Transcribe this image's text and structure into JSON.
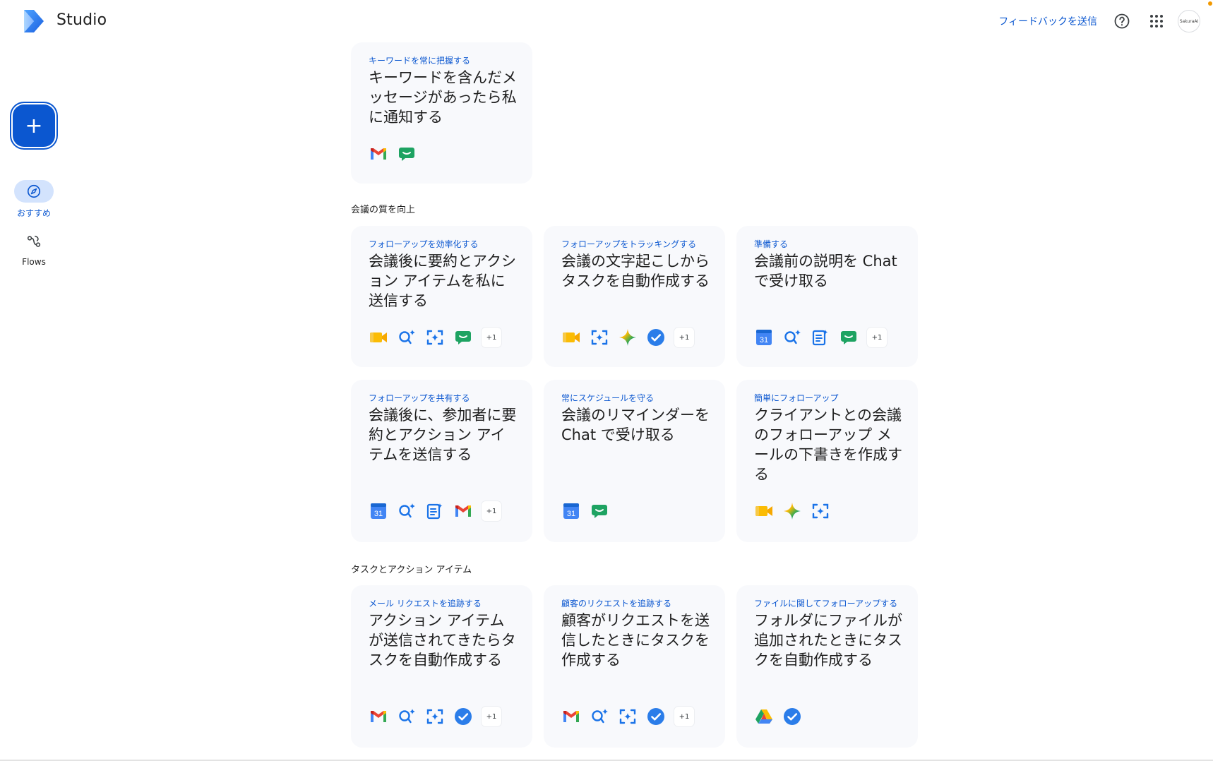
{
  "app": {
    "title": "Studio"
  },
  "header": {
    "feedback_label": "フィードバックを送信",
    "avatar_text": "SakuraAI"
  },
  "nav": {
    "create_label": "+",
    "items": [
      {
        "label": "おすすめ",
        "icon": "compass-icon",
        "active": true
      },
      {
        "label": "Flows",
        "icon": "flows-icon",
        "active": false
      }
    ]
  },
  "sections": [
    {
      "title": "会議の質を向上"
    },
    {
      "title": "タスクとアクション アイテム"
    }
  ],
  "cards": [
    {
      "subtitle": "キーワードを常に把握する",
      "title": "キーワードを含んだメッセージがあったら私に通知する",
      "icons": [
        "gmail-icon",
        "chat-icon"
      ],
      "more": ""
    },
    {
      "subtitle": "フォローアップを効率化する",
      "title": "会議後に要約とアクション アイテムを私に送信する",
      "icons": [
        "meet-icon",
        "gemini-task-icon",
        "capture-icon",
        "chat-icon"
      ],
      "more": "+1"
    },
    {
      "subtitle": "フォローアップをトラッキングする",
      "title": "会議の文字起こしからタスクを自動作成する",
      "icons": [
        "meet-icon",
        "capture-icon",
        "gemini-icon",
        "tasks-icon"
      ],
      "more": "+1"
    },
    {
      "subtitle": "準備する",
      "title": "会議前の説明を Chat で受け取る",
      "icons": [
        "calendar-icon",
        "gemini-task-icon",
        "notes-icon",
        "chat-icon"
      ],
      "more": "+1"
    },
    {
      "subtitle": "フォローアップを共有する",
      "title": "会議後に、参加者に要約とアクション アイテムを送信する",
      "icons": [
        "calendar-icon",
        "gemini-task-icon",
        "notes-icon",
        "gmail-icon"
      ],
      "more": "+1"
    },
    {
      "subtitle": "常にスケジュールを守る",
      "title": "会議のリマインダーを Chat で受け取る",
      "icons": [
        "calendar-icon",
        "chat-icon"
      ],
      "more": ""
    },
    {
      "subtitle": "簡単にフォローアップ",
      "title": "クライアントとの会議のフォローアップ メールの下書きを作成する",
      "icons": [
        "meet-icon",
        "gemini-icon",
        "capture-icon"
      ],
      "more": ""
    },
    {
      "subtitle": "メール リクエストを追跡する",
      "title": "アクション アイテムが送信されてきたらタスクを自動作成する",
      "icons": [
        "gmail-icon",
        "gemini-task-icon",
        "capture-icon",
        "tasks-icon"
      ],
      "more": "+1"
    },
    {
      "subtitle": "顧客のリクエストを追跡する",
      "title": "顧客がリクエストを送信したときにタスクを作成する",
      "icons": [
        "gmail-icon",
        "gemini-task-icon",
        "capture-icon",
        "tasks-icon"
      ],
      "more": "+1"
    },
    {
      "subtitle": "ファイルに関してフォローアップする",
      "title": "フォルダにファイルが追加されたときにタスクを自動作成する",
      "icons": [
        "drive-icon",
        "tasks-icon"
      ],
      "more": ""
    }
  ],
  "calendar_day": "31",
  "colors": {
    "accent": "#0b57d0",
    "card_bg": "#f8f9fc",
    "nav_active_bg": "#d3e3fd"
  }
}
